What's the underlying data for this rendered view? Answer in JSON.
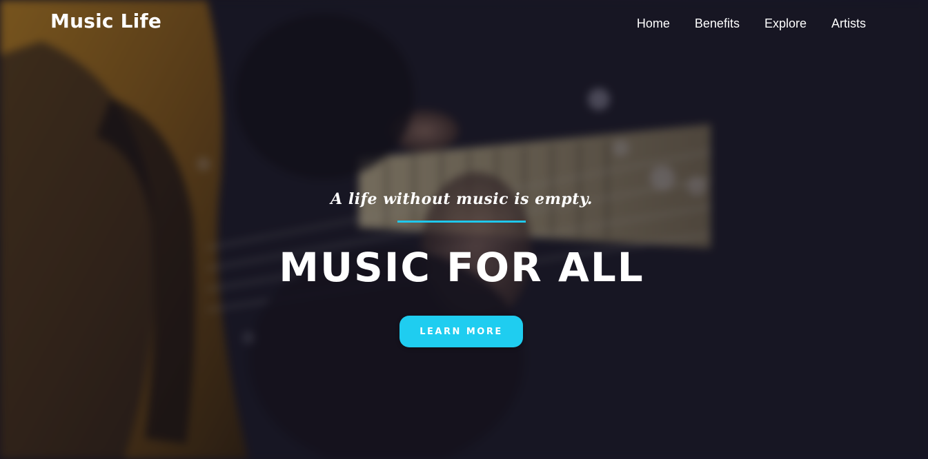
{
  "brand": {
    "name": "Music Life"
  },
  "nav": {
    "items": [
      {
        "label": "Home"
      },
      {
        "label": "Benefits"
      },
      {
        "label": "Explore"
      },
      {
        "label": "Artists"
      }
    ]
  },
  "hero": {
    "tagline": "A life without music is empty.",
    "headline": "MUSIC FOR ALL",
    "cta_label": "LEARN MORE",
    "background_image": "blurred photo of a person playing a bass guitar"
  },
  "colors": {
    "accent": "#1fcdf0",
    "text": "#ffffff",
    "background": "#1c1a26"
  }
}
